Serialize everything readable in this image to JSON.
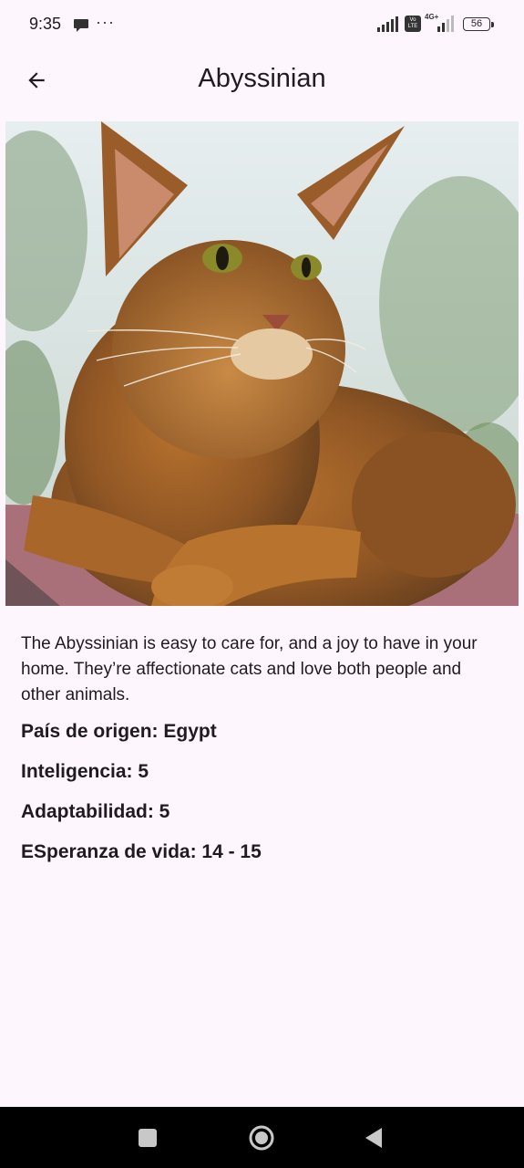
{
  "status_bar": {
    "time": "9:35",
    "more": "···",
    "network_label": "4G+",
    "volte_label": "Vo LTE",
    "battery": "56"
  },
  "app_bar": {
    "title": "Abyssinian",
    "back_icon": "arrow-back-icon"
  },
  "breed": {
    "image_alt": "Abyssinian cat lying on a stone ledge",
    "description": "The Abyssinian is easy to care for, and a joy to have in your home. They’re affectionate cats and love both people and other animals.",
    "origin": "País de origen: Egypt",
    "intelligence": "Inteligencia: 5",
    "adaptability": "Adaptabilidad: 5",
    "life_span": "ESperanza de vida: 14 - 15"
  },
  "nav_bar": {
    "recents_icon": "square-icon",
    "home_icon": "circle-icon",
    "back_icon": "triangle-back-icon"
  },
  "colors": {
    "background": "#fdf7fd",
    "text": "#1f1b20",
    "nav_bar": "#000000"
  }
}
